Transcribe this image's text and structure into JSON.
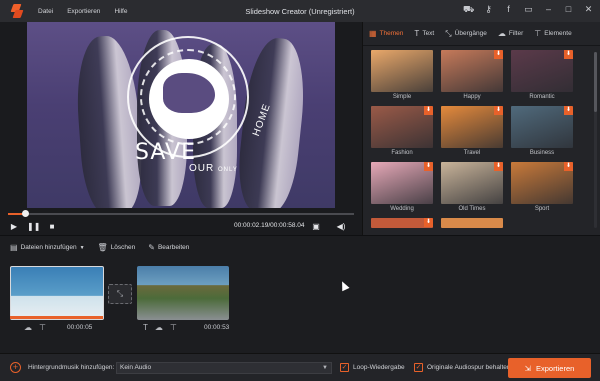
{
  "app": {
    "title": "Slideshow Creator (Unregistriert)",
    "menu": [
      "Datei",
      "Exportieren",
      "Hilfe"
    ]
  },
  "preview": {
    "overlay_big": "SAVE",
    "overlay_small": "OUR",
    "overlay_small2": "ONLY",
    "overlay_home": "HOME",
    "timecode": "00:00:02.19/00:00:58.04",
    "progress_fraction": 0.05
  },
  "tabs": [
    {
      "label": "Themen",
      "icon": "grid-icon",
      "active": true
    },
    {
      "label": "Text",
      "icon": "text-icon"
    },
    {
      "label": "Übergänge",
      "icon": "transition-icon"
    },
    {
      "label": "Filter",
      "icon": "filter-icon"
    },
    {
      "label": "Elemente",
      "icon": "elements-icon"
    }
  ],
  "themes": [
    {
      "label": "Simple",
      "color": "#e9a86a",
      "badge": false
    },
    {
      "label": "Happy",
      "color": "#c67a5a",
      "badge": true
    },
    {
      "label": "Romantic",
      "color": "#5b3a4a",
      "badge": true
    },
    {
      "label": "Fashion",
      "color": "#9a5a48",
      "badge": true
    },
    {
      "label": "Travel",
      "color": "#e58a3c",
      "badge": true
    },
    {
      "label": "Business",
      "color": "#506a7c",
      "badge": true
    },
    {
      "label": "Wedding",
      "color": "#e7a9b8",
      "badge": true
    },
    {
      "label": "Old Times",
      "color": "#c9b49a",
      "badge": true
    },
    {
      "label": "Sport",
      "color": "#c97a3a",
      "badge": true
    }
  ],
  "timeline": {
    "toolbar": {
      "add_files": "Dateien hinzufügen",
      "delete": "Löschen",
      "edit": "Bearbeiten"
    },
    "clips": [
      {
        "duration": "00:00:05"
      },
      {
        "duration": "00:00:53"
      }
    ]
  },
  "bottom": {
    "music_label": "Hintergrundmusik hinzufügen:",
    "music_value": "Kein Audio",
    "loop_label": "Loop-Wiedergabe",
    "keep_audio_label": "Originale Audiospur behalten",
    "export_label": "Exportieren"
  }
}
